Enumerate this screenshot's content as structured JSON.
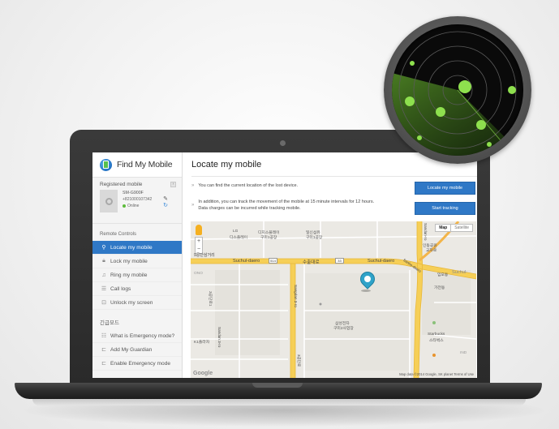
{
  "app": {
    "name": "Find My Mobile"
  },
  "sidebar": {
    "registered_title": "Registered mobile",
    "device": {
      "model": "SM-G900F",
      "number": "+821000107342",
      "status": "Online"
    },
    "remote_controls_title": "Remote Controls",
    "remote_controls": [
      {
        "label": "Locate my mobile",
        "icon": "search-icon",
        "active": true
      },
      {
        "label": "Lock my mobile",
        "icon": "lock-icon",
        "active": false
      },
      {
        "label": "Ring my mobile",
        "icon": "music-note-icon",
        "active": false
      },
      {
        "label": "Call logs",
        "icon": "list-icon",
        "active": false
      },
      {
        "label": "Unlock my screen",
        "icon": "unlock-icon",
        "active": false
      }
    ],
    "emergency_title": "긴급모드",
    "emergency_items": [
      {
        "label": "What is Emergency mode?",
        "icon": "info-list-icon"
      },
      {
        "label": "Add My Guardian",
        "icon": "add-guardian-icon"
      },
      {
        "label": "Enable Emergency mode",
        "icon": "enable-icon"
      }
    ]
  },
  "main": {
    "title": "Locate my mobile",
    "info_1": "You can find the current location of the lost device.",
    "info_2_line1": "In addition, you can track the movement of the mobile at 15 minute intervals for 12 hours.",
    "info_2_line2": "Data charges can be incurred while tracking mobile.",
    "locate_button": "Locate my mobile",
    "track_button": "Start tracking"
  },
  "map": {
    "map_type": "Map",
    "satellite_type": "Satellite",
    "copyright": "Map data ©2014 Google, SK planet   Terms of Use",
    "google": "Google",
    "zoom_in": "+",
    "zoom_out": "−",
    "labels": {
      "lg": "LG",
      "lg_sub": "디스플레이",
      "lg_display": "디지스플레이",
      "lg_display_sub": "구미1공장",
      "ilshin": "일신섬유",
      "ilshin_sub": "구미1공장",
      "samsung": "삼성전자",
      "samsung_sub": "구미2사업장",
      "byeongweon": "가전동",
      "starbucks": "Starbucks",
      "starbucks_sub": "스타벅스",
      "dong_label": "임오동",
      "nondong": "인동공원",
      "nondong_sub": "교차로",
      "left_label": "3공단로1",
      "k_label": "K1플라자",
      "ono": "ONO",
      "ind": "IND"
    },
    "roads": {
      "suchul_dae": "Suchul-daero",
      "suchul_kr": "수출대로",
      "suchul_daero_2": "Suchul-daero",
      "suchul_right": "Suchul-",
      "gongdan": "3공단로",
      "left_big": "9공단삼거리",
      "sanho": "Sanho-daero",
      "vertical_1": "Sangdan 3-ro",
      "vertical_2": "Sandan 3-ro",
      "gongdan_right": "Sandan-ro",
      "highway_1": "514",
      "highway_2": "33"
    }
  },
  "colors": {
    "primary": "#2f78c6",
    "online": "#5dbb3b",
    "pin": "#2fa3c9",
    "radar_dot": "#8ee04e"
  }
}
